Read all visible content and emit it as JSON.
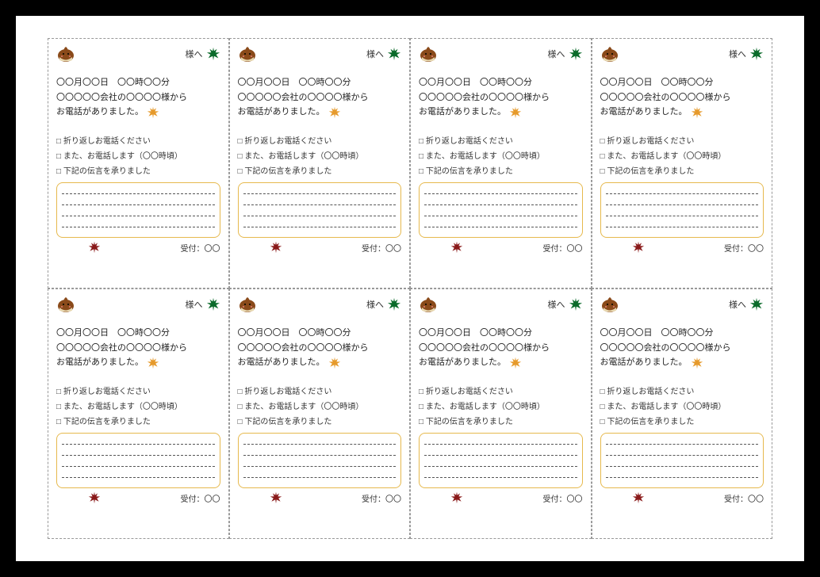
{
  "card": {
    "header_suffix": "様へ",
    "body_line1": "〇〇月〇〇日　〇〇時〇〇分",
    "body_line2": "〇〇〇〇〇会社の〇〇〇〇様から",
    "body_line3": "お電話がありました。",
    "checks": [
      "折り返しお電話ください",
      "また、お電話します（〇〇時頃）",
      "下記の伝言を承りました"
    ],
    "footer_label": "受付：〇〇"
  },
  "layout": {
    "rows": 2,
    "cols": 4
  },
  "icons": {
    "chestnut": "chestnut-icon",
    "maple_green": "maple-green-icon",
    "maple_orange": "maple-orange-icon",
    "maple_red": "maple-red-icon"
  }
}
